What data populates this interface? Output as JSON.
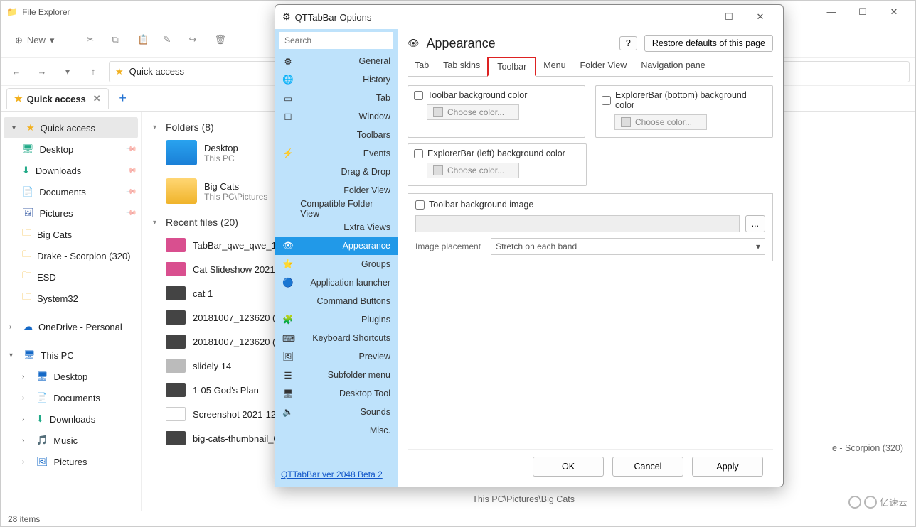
{
  "explorer": {
    "title": "File Explorer",
    "new_label": "New",
    "address": "Quick access",
    "tab_label": "Quick access",
    "items_status": "28 items",
    "breadcrumb_right_top": "e - Scorpion (320)",
    "breadcrumb_right_bottom": "This PC\\Pictures\\Big Cats"
  },
  "tree": {
    "quick_access": "Quick access",
    "desktop": "Desktop",
    "downloads": "Downloads",
    "documents": "Documents",
    "pictures": "Pictures",
    "big_cats": "Big Cats",
    "drake": "Drake - Scorpion (320)",
    "esd": "ESD",
    "system32": "System32",
    "onedrive": "OneDrive - Personal",
    "this_pc": "This PC",
    "pc_desktop": "Desktop",
    "pc_documents": "Documents",
    "pc_downloads": "Downloads",
    "pc_music": "Music",
    "pc_pictures": "Pictures"
  },
  "content": {
    "folders_header": "Folders (8)",
    "recent_header": "Recent files (20)",
    "f1_name": "Desktop",
    "f1_path": "This PC",
    "f2_name": "Big Cats",
    "f2_path": "This PC\\Pictures",
    "files": [
      "TabBar_qwe_qwe_1_Ta",
      "Cat Slideshow 2021",
      "cat 1",
      "20181007_123620 (2)",
      "20181007_123620 (1)",
      "slidely 14",
      "1-05 God's Plan",
      "Screenshot 2021-12-2",
      "big-cats-thumbnail_02"
    ]
  },
  "dialog": {
    "title": "QTTabBar Options",
    "search_placeholder": "Search",
    "heading": "Appearance",
    "restore_btn": "Restore defaults of this page",
    "version": "QTTabBar ver 2048 Beta 2",
    "cats": [
      "General",
      "History",
      "Tab",
      "Window",
      "Toolbars",
      "Events",
      "Drag & Drop",
      "Folder View",
      "Compatible Folder View",
      "Extra Views",
      "Appearance",
      "Groups",
      "Application launcher",
      "Command Buttons",
      "Plugins",
      "Keyboard Shortcuts",
      "Preview",
      "Subfolder menu",
      "Desktop Tool",
      "Sounds",
      "Misc."
    ],
    "tabs": [
      "Tab",
      "Tab skins",
      "Toolbar",
      "Menu",
      "Folder View",
      "Navigation pane"
    ],
    "chk_toolbar_bg": "Toolbar background color",
    "chk_explorer_bottom": "ExplorerBar (bottom) background color",
    "chk_explorer_left": "ExplorerBar (left) background color",
    "choose_color": "Choose color...",
    "chk_toolbar_img": "Toolbar background image",
    "browse": "...",
    "placement_label": "Image placement",
    "placement_value": "Stretch on each band",
    "ok": "OK",
    "cancel": "Cancel",
    "apply": "Apply"
  },
  "watermark": "亿速云"
}
